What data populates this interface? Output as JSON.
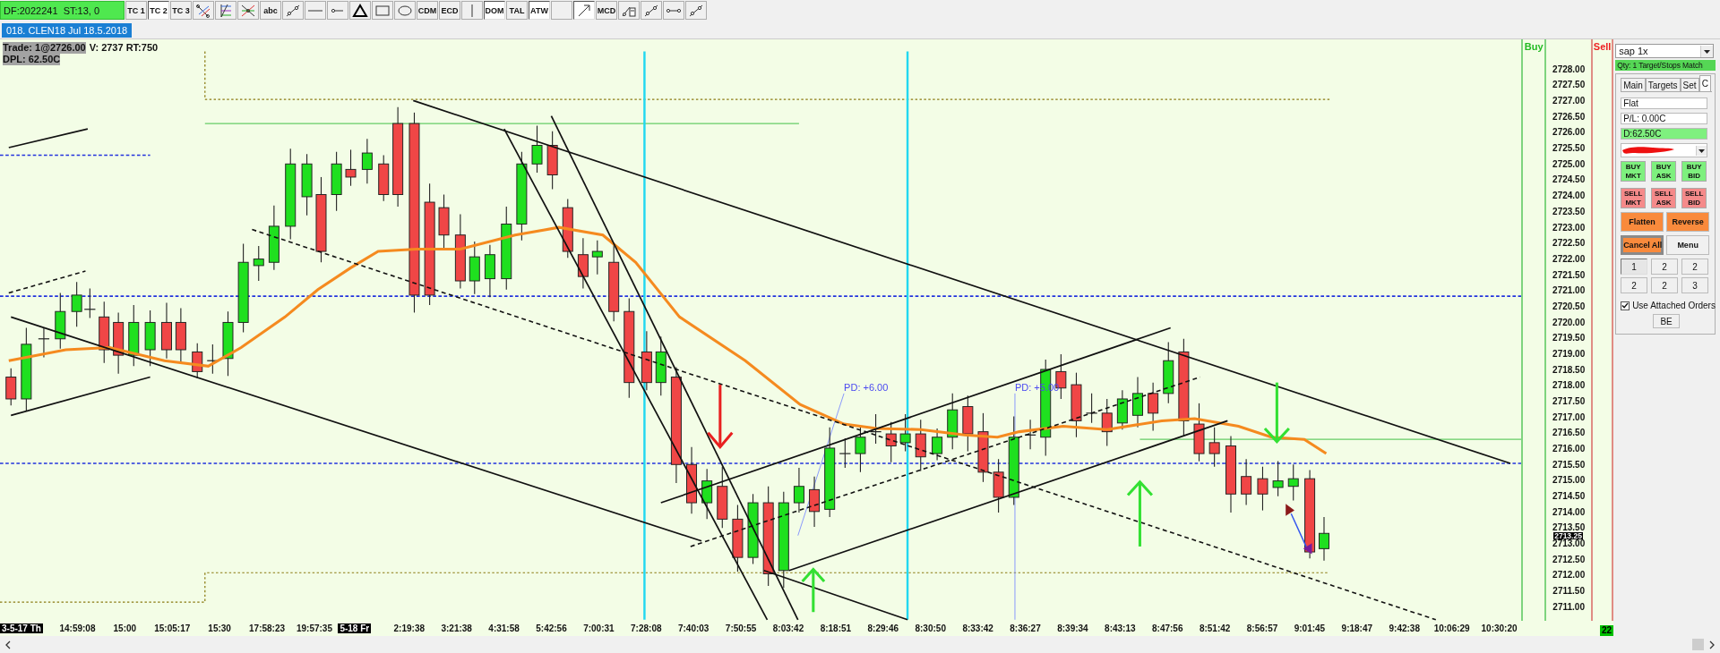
{
  "toolbar": {
    "status": "DF:2022241  ST:13, 0",
    "buttons": [
      {
        "kind": "text",
        "label": "TC 1",
        "selected": false
      },
      {
        "kind": "text",
        "label": "TC 2",
        "selected": true
      },
      {
        "kind": "text",
        "label": "TC 3",
        "selected": false
      },
      {
        "kind": "icon",
        "selected": false
      },
      {
        "kind": "icon",
        "selected": false
      },
      {
        "kind": "icon",
        "selected": false
      },
      {
        "kind": "text",
        "label": "abc",
        "selected": false
      },
      {
        "kind": "icon",
        "selected": false
      },
      {
        "kind": "icon",
        "selected": false
      },
      {
        "kind": "icon",
        "selected": false
      },
      {
        "kind": "icon",
        "selected": false
      },
      {
        "kind": "icon",
        "selected": false
      },
      {
        "kind": "icon",
        "selected": false
      },
      {
        "kind": "text",
        "label": "CDM",
        "selected": false
      },
      {
        "kind": "text",
        "label": "ECD",
        "selected": false
      },
      {
        "kind": "icon",
        "selected": false
      },
      {
        "kind": "text",
        "label": "DOM",
        "selected": true
      },
      {
        "kind": "text",
        "label": "TAL",
        "selected": false
      },
      {
        "kind": "text",
        "label": "ATW",
        "selected": true
      },
      {
        "kind": "blank",
        "selected": false
      },
      {
        "kind": "icon",
        "selected": true
      },
      {
        "kind": "text",
        "label": "MCD",
        "selected": false
      },
      {
        "kind": "icon",
        "selected": false
      },
      {
        "kind": "icon",
        "selected": false
      },
      {
        "kind": "icon",
        "selected": false
      },
      {
        "kind": "icon",
        "selected": false
      }
    ]
  },
  "chart_tab": "018. CLEN18 Jul 18.5.2018",
  "info": {
    "trade": "Trade: 1@2726.00",
    "volume": "V: 2737 RT:750",
    "dpl": "DPL: 62.50C"
  },
  "annotations": [
    "PD: +6.00",
    "PD: +5.00"
  ],
  "columns": {
    "buy": "Buy",
    "sell": "Sell"
  },
  "price_axis": {
    "labels": [
      "2728.00",
      "2727.50",
      "2727.00",
      "2726.50",
      "2726.00",
      "2725.50",
      "2725.00",
      "2724.50",
      "2724.00",
      "2723.50",
      "2723.00",
      "2722.50",
      "2722.00",
      "2721.50",
      "2721.00",
      "2720.50",
      "2720.00",
      "2719.50",
      "2719.00",
      "2718.50",
      "2718.00",
      "2717.50",
      "2717.00",
      "2716.50",
      "2716.00",
      "2715.50",
      "2715.00",
      "2714.50",
      "2714.00",
      "2713.50",
      "2713.00",
      "2712.50",
      "2712.00",
      "2711.50",
      "2711.00"
    ],
    "last_price": "2713.25"
  },
  "time_axis": [
    {
      "label": "3-5-17 Th",
      "kind": "date"
    },
    {
      "label": "14:59:08",
      "kind": "time"
    },
    {
      "label": "15:00",
      "kind": "time"
    },
    {
      "label": "15:05:17",
      "kind": "time"
    },
    {
      "label": "15:30",
      "kind": "time"
    },
    {
      "label": "17:58:23",
      "kind": "time"
    },
    {
      "label": "19:57:35",
      "kind": "time"
    },
    {
      "label": "5-18 Fr",
      "kind": "date"
    },
    {
      "label": "2:19:38",
      "kind": "time"
    },
    {
      "label": "3:21:38",
      "kind": "time"
    },
    {
      "label": "4:31:58",
      "kind": "time"
    },
    {
      "label": "5:42:56",
      "kind": "time"
    },
    {
      "label": "7:00:31",
      "kind": "time"
    },
    {
      "label": "7:28:08",
      "kind": "time"
    },
    {
      "label": "7:40:03",
      "kind": "time"
    },
    {
      "label": "7:50:55",
      "kind": "time"
    },
    {
      "label": "8:03:42",
      "kind": "time"
    },
    {
      "label": "8:18:51",
      "kind": "time"
    },
    {
      "label": "8:29:46",
      "kind": "time"
    },
    {
      "label": "8:30:50",
      "kind": "time"
    },
    {
      "label": "8:33:42",
      "kind": "time"
    },
    {
      "label": "8:36:27",
      "kind": "time"
    },
    {
      "label": "8:39:34",
      "kind": "time"
    },
    {
      "label": "8:43:13",
      "kind": "time"
    },
    {
      "label": "8:47:56",
      "kind": "time"
    },
    {
      "label": "8:51:42",
      "kind": "time"
    },
    {
      "label": "8:56:57",
      "kind": "time"
    },
    {
      "label": "9:01:45",
      "kind": "time"
    },
    {
      "label": "9:18:47",
      "kind": "time"
    },
    {
      "label": "9:42:38",
      "kind": "time"
    },
    {
      "label": "10:06:29",
      "kind": "time"
    },
    {
      "label": "10:30:20",
      "kind": "time"
    }
  ],
  "count_badge": "22",
  "panel": {
    "account": "sap 1x",
    "status": "Qty: 1 Target/Stops Match",
    "tabs": [
      {
        "label": "Main",
        "selected": false
      },
      {
        "label": "Targets",
        "selected": false
      },
      {
        "label": "Set",
        "selected": false
      },
      {
        "label": "C",
        "selected": true
      }
    ],
    "fields": [
      {
        "value": "Flat",
        "kind": "plain"
      },
      {
        "value": "P/L: 0.00C",
        "kind": "plain"
      },
      {
        "value": "D:62.50C",
        "kind": "highlight"
      }
    ],
    "order_buttons": [
      {
        "label": "BUY MKT",
        "kind": "buy"
      },
      {
        "label": "BUY ASK",
        "kind": "buy"
      },
      {
        "label": "BUY BID",
        "kind": "buy"
      },
      {
        "label": "SELL MKT",
        "kind": "sell"
      },
      {
        "label": "SELL ASK",
        "kind": "sell"
      },
      {
        "label": "SELL BID",
        "kind": "sell"
      }
    ],
    "action_buttons": [
      {
        "label": "Flatten",
        "kind": "accent"
      },
      {
        "label": "Reverse",
        "kind": "accent"
      },
      {
        "label": "Cancel All",
        "kind": "framed"
      },
      {
        "label": "Menu",
        "kind": "plain"
      }
    ],
    "quantity_buttons": [
      {
        "label": "1",
        "selected": true
      },
      {
        "label": "2",
        "selected": false
      },
      {
        "label": "2",
        "selected": false
      },
      {
        "label": "2",
        "selected": false
      },
      {
        "label": "2",
        "selected": false
      },
      {
        "label": "3",
        "selected": false
      }
    ],
    "attached_orders": {
      "label": "Use Attached Orders",
      "checked": true
    },
    "be_button": "BE"
  }
}
